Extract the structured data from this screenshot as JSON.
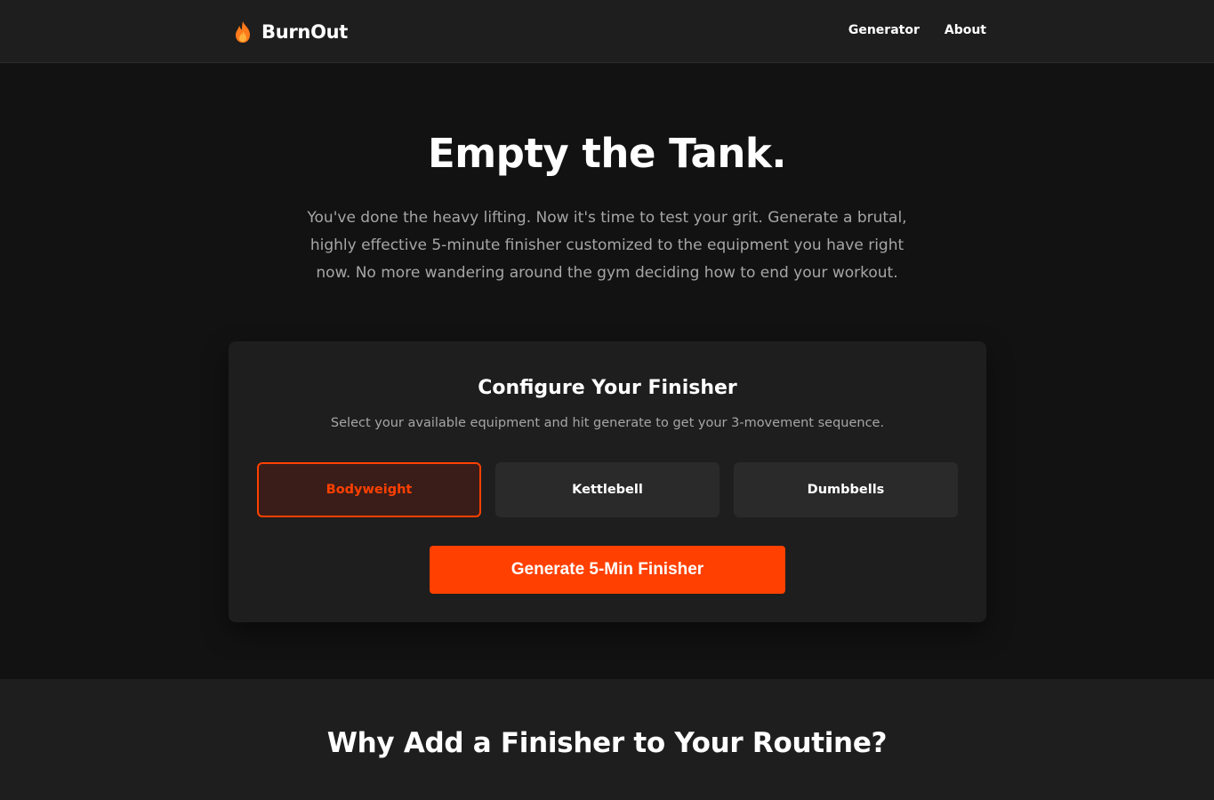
{
  "header": {
    "brand": "BurnOut",
    "brand_icon": "fire-icon",
    "nav": [
      "Generator",
      "About"
    ]
  },
  "hero": {
    "title": "Empty the Tank.",
    "subtitle": "You've done the heavy lifting. Now it's time to test your grit. Generate a brutal, highly effective 5-minute finisher customized to the equipment you have right now. No more wandering around the gym deciding how to end your workout."
  },
  "configure": {
    "title": "Configure Your Finisher",
    "subtitle": "Select your available equipment and hit generate to get your 3-movement sequence.",
    "equipment": [
      "Bodyweight",
      "Kettlebell",
      "Dumbbells"
    ],
    "selected": "Bodyweight",
    "generate_label": "Generate 5-Min Finisher"
  },
  "why": {
    "title": "Why Add a Finisher to Your Routine?"
  },
  "colors": {
    "accent": "#ff4000",
    "background": "#121212",
    "surface": "#1e1e1e",
    "muted_text": "#a6a6a6"
  }
}
